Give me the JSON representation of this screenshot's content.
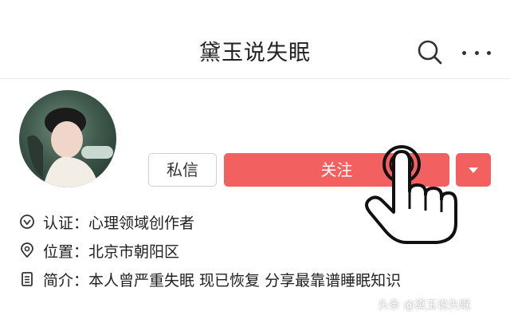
{
  "header": {
    "title": "黛玉说失眠"
  },
  "profile": {
    "message_label": "私信",
    "follow_label": "关注",
    "info": [
      {
        "icon": "verified-icon",
        "text": "认证：心理领域创作者"
      },
      {
        "icon": "location-icon",
        "text": "位置：北京市朝阳区"
      },
      {
        "icon": "document-icon",
        "text": "简介：本人曾严重失眠 现已恢复 分享最靠谱睡眠知识"
      }
    ]
  },
  "watermark": "头条 @黛玉说失眠",
  "colors": {
    "accent": "#f26160"
  }
}
